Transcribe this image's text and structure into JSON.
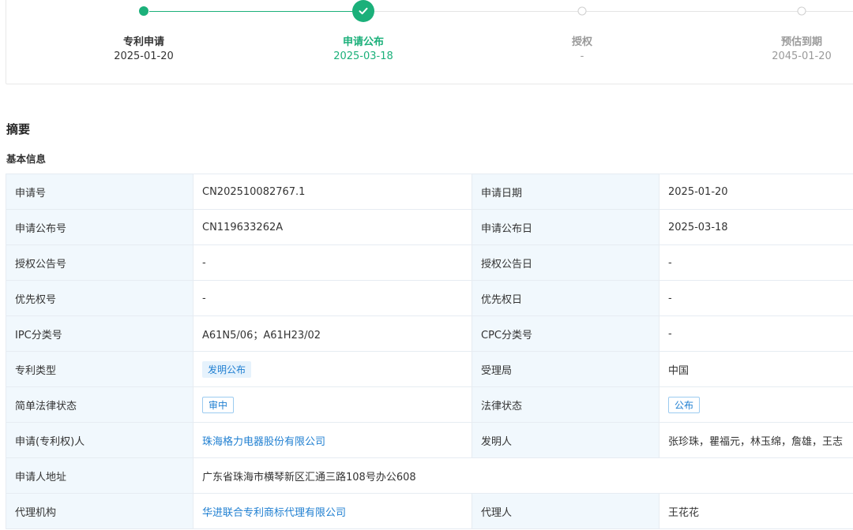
{
  "timeline": {
    "steps": [
      {
        "label": "专利申请",
        "date": "2025-01-20",
        "state": "done"
      },
      {
        "label": "申请公布",
        "date": "2025-03-18",
        "state": "current"
      },
      {
        "label": "授权",
        "date": "-",
        "state": "pending"
      },
      {
        "label": "预估到期",
        "date": "2045-01-20",
        "state": "pending"
      }
    ],
    "colors": {
      "done": "#1bb07a",
      "pending": "#cfcfcf"
    }
  },
  "section_title": "摘要",
  "basic_info": {
    "title": "基本信息",
    "rows": [
      {
        "l1": "申请号",
        "v1": "CN202510082767.1",
        "l2": "申请日期",
        "v2": "2025-01-20"
      },
      {
        "l1": "申请公布号",
        "v1": "CN119633262A",
        "l2": "申请公布日",
        "v2": "2025-03-18"
      },
      {
        "l1": "授权公告号",
        "v1": "-",
        "l2": "授权公告日",
        "v2": "-"
      },
      {
        "l1": "优先权号",
        "v1": "-",
        "l2": "优先权日",
        "v2": "-"
      },
      {
        "l1": "IPC分类号",
        "v1": "A61N5/06；A61H23/02",
        "l2": "CPC分类号",
        "v2": "-"
      },
      {
        "l1": "专利类型",
        "v1": "发明公布",
        "l2": "受理局",
        "v2": "中国"
      },
      {
        "l1": "简单法律状态",
        "v1": "审中",
        "l2": "法律状态",
        "v2": "公布"
      },
      {
        "l1": "申请(专利权)人",
        "v1": "珠海格力电器股份有限公司",
        "l2": "发明人",
        "v2": "张珍珠，瞿福元，林玉绵，詹雄，王志"
      },
      {
        "l1": "申请人地址",
        "v1": "广东省珠海市横琴新区汇通三路108号办公608"
      },
      {
        "l1": "代理机构",
        "v1": "华进联合专利商标代理有限公司",
        "l2": "代理人",
        "v2": "王花花"
      }
    ]
  },
  "accent_colors": {
    "link": "#1f7fd1",
    "label_bg": "#f1f8fd"
  }
}
